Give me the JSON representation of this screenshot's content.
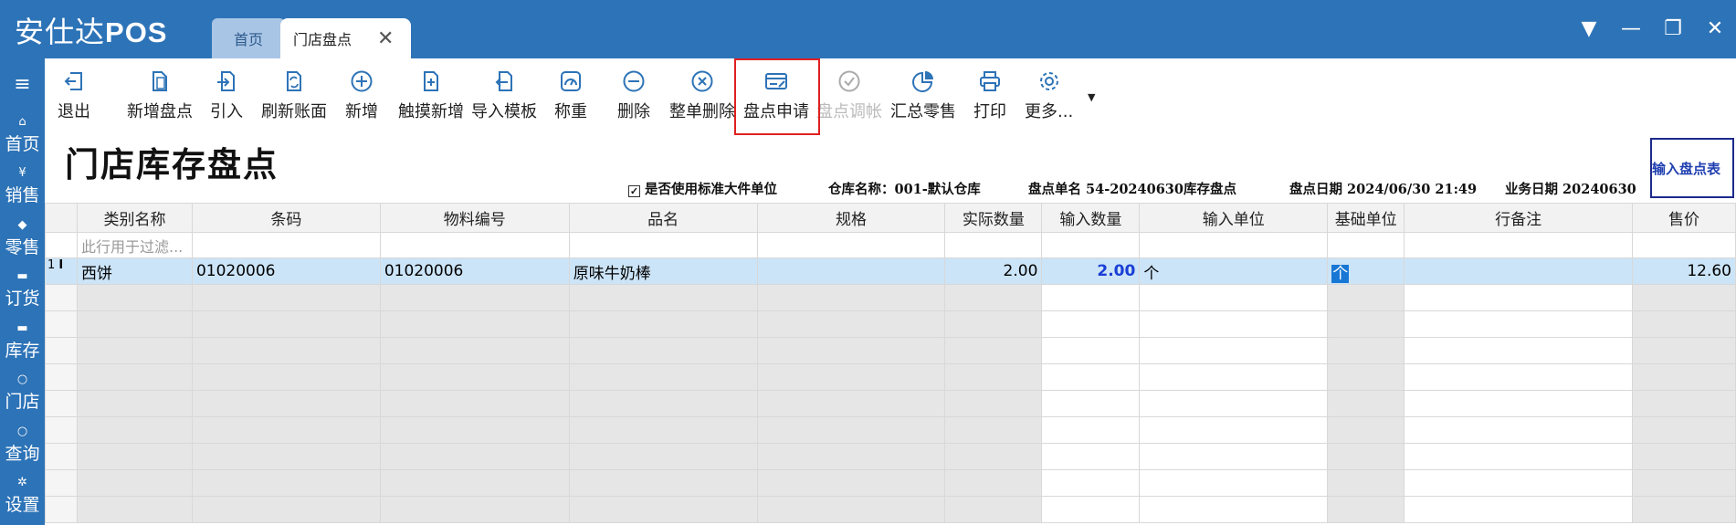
{
  "app": {
    "logo_cn": "安仕达",
    "logo_en": "POS"
  },
  "tabs": [
    {
      "label": "首页"
    },
    {
      "label": "门店盘点"
    }
  ],
  "window_buttons": [
    "▼",
    "—",
    "❐",
    "✕"
  ],
  "sidebar": {
    "items": [
      {
        "label": "首页",
        "icon": "home-icon"
      },
      {
        "label": "销售",
        "icon": "yen-icon"
      },
      {
        "label": "零售",
        "icon": "tag-icon"
      },
      {
        "label": "订货",
        "icon": "cart-icon"
      },
      {
        "label": "库存",
        "icon": "box-icon"
      },
      {
        "label": "门店",
        "icon": "search-icon"
      },
      {
        "label": "查询",
        "icon": "search-icon"
      },
      {
        "label": "设置",
        "icon": "gear-icon"
      }
    ]
  },
  "toolbar": {
    "exit": "退出",
    "new_count": "新增盘点",
    "import": "引入",
    "refresh": "刷新账面",
    "add": "新增",
    "touch_add": "触摸新增",
    "import_template": "导入模板",
    "weigh": "称重",
    "delete": "删除",
    "delete_all": "整单删除",
    "count_apply": "盘点申请",
    "count_adjust": "盘点调帐",
    "summary_retail": "汇总零售",
    "print": "打印",
    "more": "更多..."
  },
  "page": {
    "title": "门店库存盘点",
    "use_std_unit": "是否使用标准大件单位",
    "warehouse": "仓库名称：001-默认仓库",
    "count_no": "盘点单名 54-20240630库存盘点",
    "count_date": "盘点日期 2024/06/30 21:49",
    "biz_date": "业务日期 20240630",
    "input_btn": "输入盘点表"
  },
  "table": {
    "headers": [
      "类别名称",
      "条码",
      "物料编号",
      "品名",
      "规格",
      "实际数量",
      "输入数量",
      "输入单位",
      "基础单位",
      "行备注",
      "售价"
    ],
    "filter_placeholder": "此行用于过滤...",
    "rows": [
      {
        "rn": "1",
        "cursor": "I",
        "category": "西饼",
        "barcode": "01020006",
        "code": "01020006",
        "name": "原味牛奶棒",
        "spec": "",
        "actual_qty": "2.00",
        "input_qty": "2.00",
        "input_unit": "个",
        "base_unit": "个",
        "note": "",
        "price": "12.60"
      }
    ]
  }
}
